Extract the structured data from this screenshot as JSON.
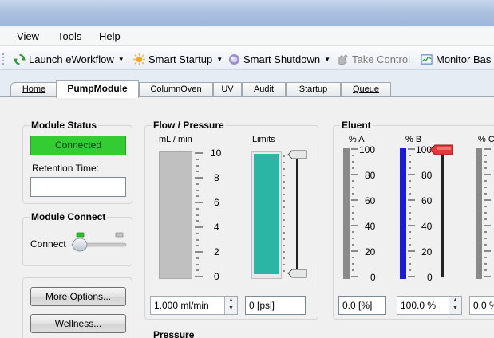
{
  "menu": {
    "items": [
      "View",
      "Tools",
      "Help"
    ]
  },
  "toolbar": {
    "launch_label": "Launch eWorkflow",
    "smart_startup_label": "Smart Startup",
    "smart_shutdown_label": "Smart Shutdown",
    "take_control_label": "Take Control",
    "monitor_label": "Monitor Bas"
  },
  "tabs": [
    {
      "label": "Home"
    },
    {
      "label": "PumpModule"
    },
    {
      "label": "ColumnOven"
    },
    {
      "label": "UV"
    },
    {
      "label": "Audit"
    },
    {
      "label": "Startup"
    },
    {
      "label": "Queue"
    }
  ],
  "module_status": {
    "title": "Module Status",
    "status": "Connected",
    "status_color": "#33cc33",
    "retention_label": "Retention Time:",
    "retention_value": ""
  },
  "module_connect": {
    "title": "Module Connect",
    "connect_label": "Connect",
    "state": "connected"
  },
  "buttons": {
    "more_options": "More Options...",
    "wellness": "Wellness..."
  },
  "flow_pressure": {
    "title": "Flow / Pressure",
    "flow_unit_label": "mL / min",
    "limits_label": "Limits",
    "flow_scale": [
      "10",
      "8",
      "6",
      "4",
      "2",
      "0"
    ],
    "flow_value": "1.000 ml/min",
    "pressure_value": "0 [psi]",
    "flow_fill_fraction": 0,
    "limit_bar_color": "#2bb5a5"
  },
  "eluent": {
    "title": "Eluent",
    "a_label": "% A",
    "b_label": "% B",
    "c_label": "% C",
    "scale": [
      "100",
      "80",
      "60",
      "40",
      "20",
      "0"
    ],
    "a_value": "0.0 [%]",
    "b_value": "100.0 %",
    "c_value": "0.0 %",
    "a_fraction": 1.0,
    "b_fraction": 1.0,
    "c_fraction": 1.0,
    "a_color": "#8a8a8a",
    "b_color": "#1a1ad8",
    "c_color": "#8a8a8a"
  },
  "pressure_section": {
    "title": "Pressure"
  }
}
